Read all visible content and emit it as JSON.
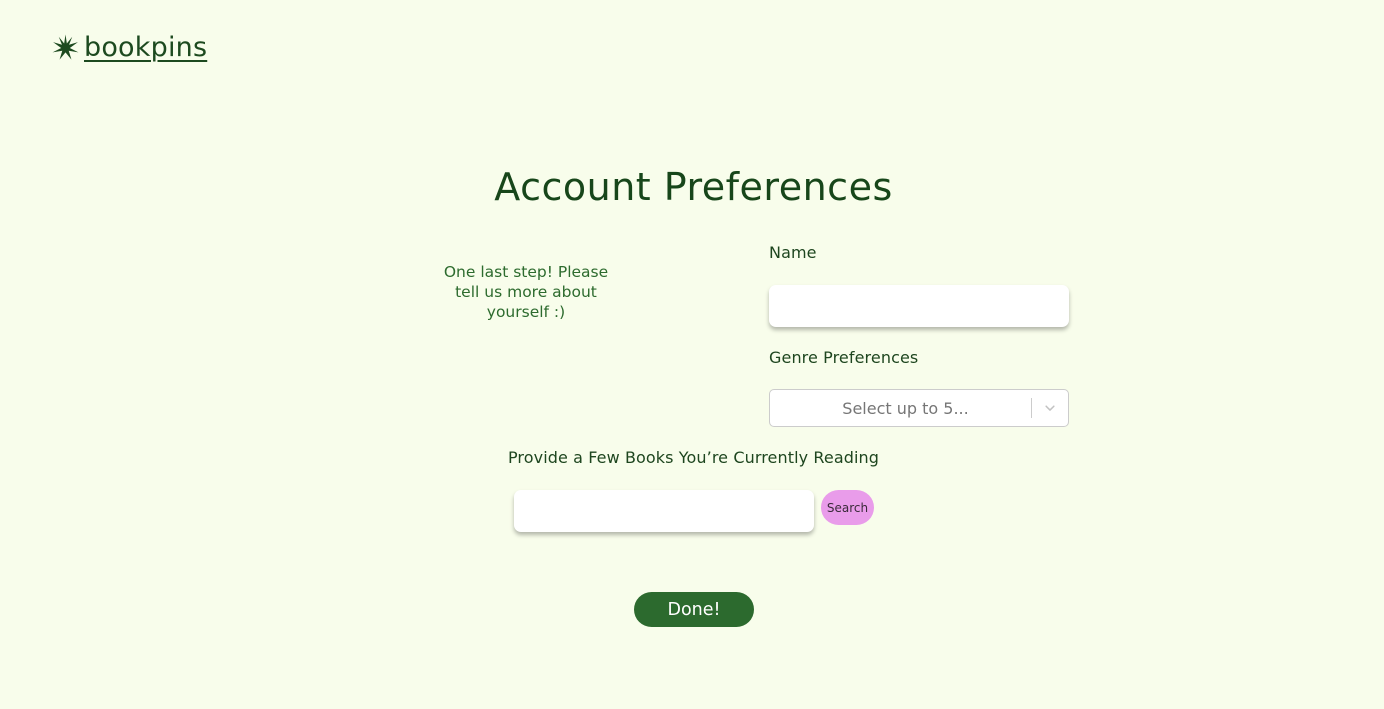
{
  "brand": {
    "name": "bookpins",
    "icon": "sparkle-star-icon",
    "color": "#1d4a1f"
  },
  "page": {
    "title": "Account Preferences",
    "intro": "One last step! Please tell us more about yourself :)"
  },
  "form": {
    "name_label": "Name",
    "name_value": "",
    "genre_label": "Genre Preferences",
    "genre_placeholder": "Select up to 5...",
    "books_label": "Provide a Few Books You’re Currently Reading",
    "books_value": "",
    "search_label": "Search",
    "done_label": "Done!"
  },
  "colors": {
    "background": "#f8fdeb",
    "primary_green": "#2c6a2e",
    "search_pink": "#e99cea"
  }
}
